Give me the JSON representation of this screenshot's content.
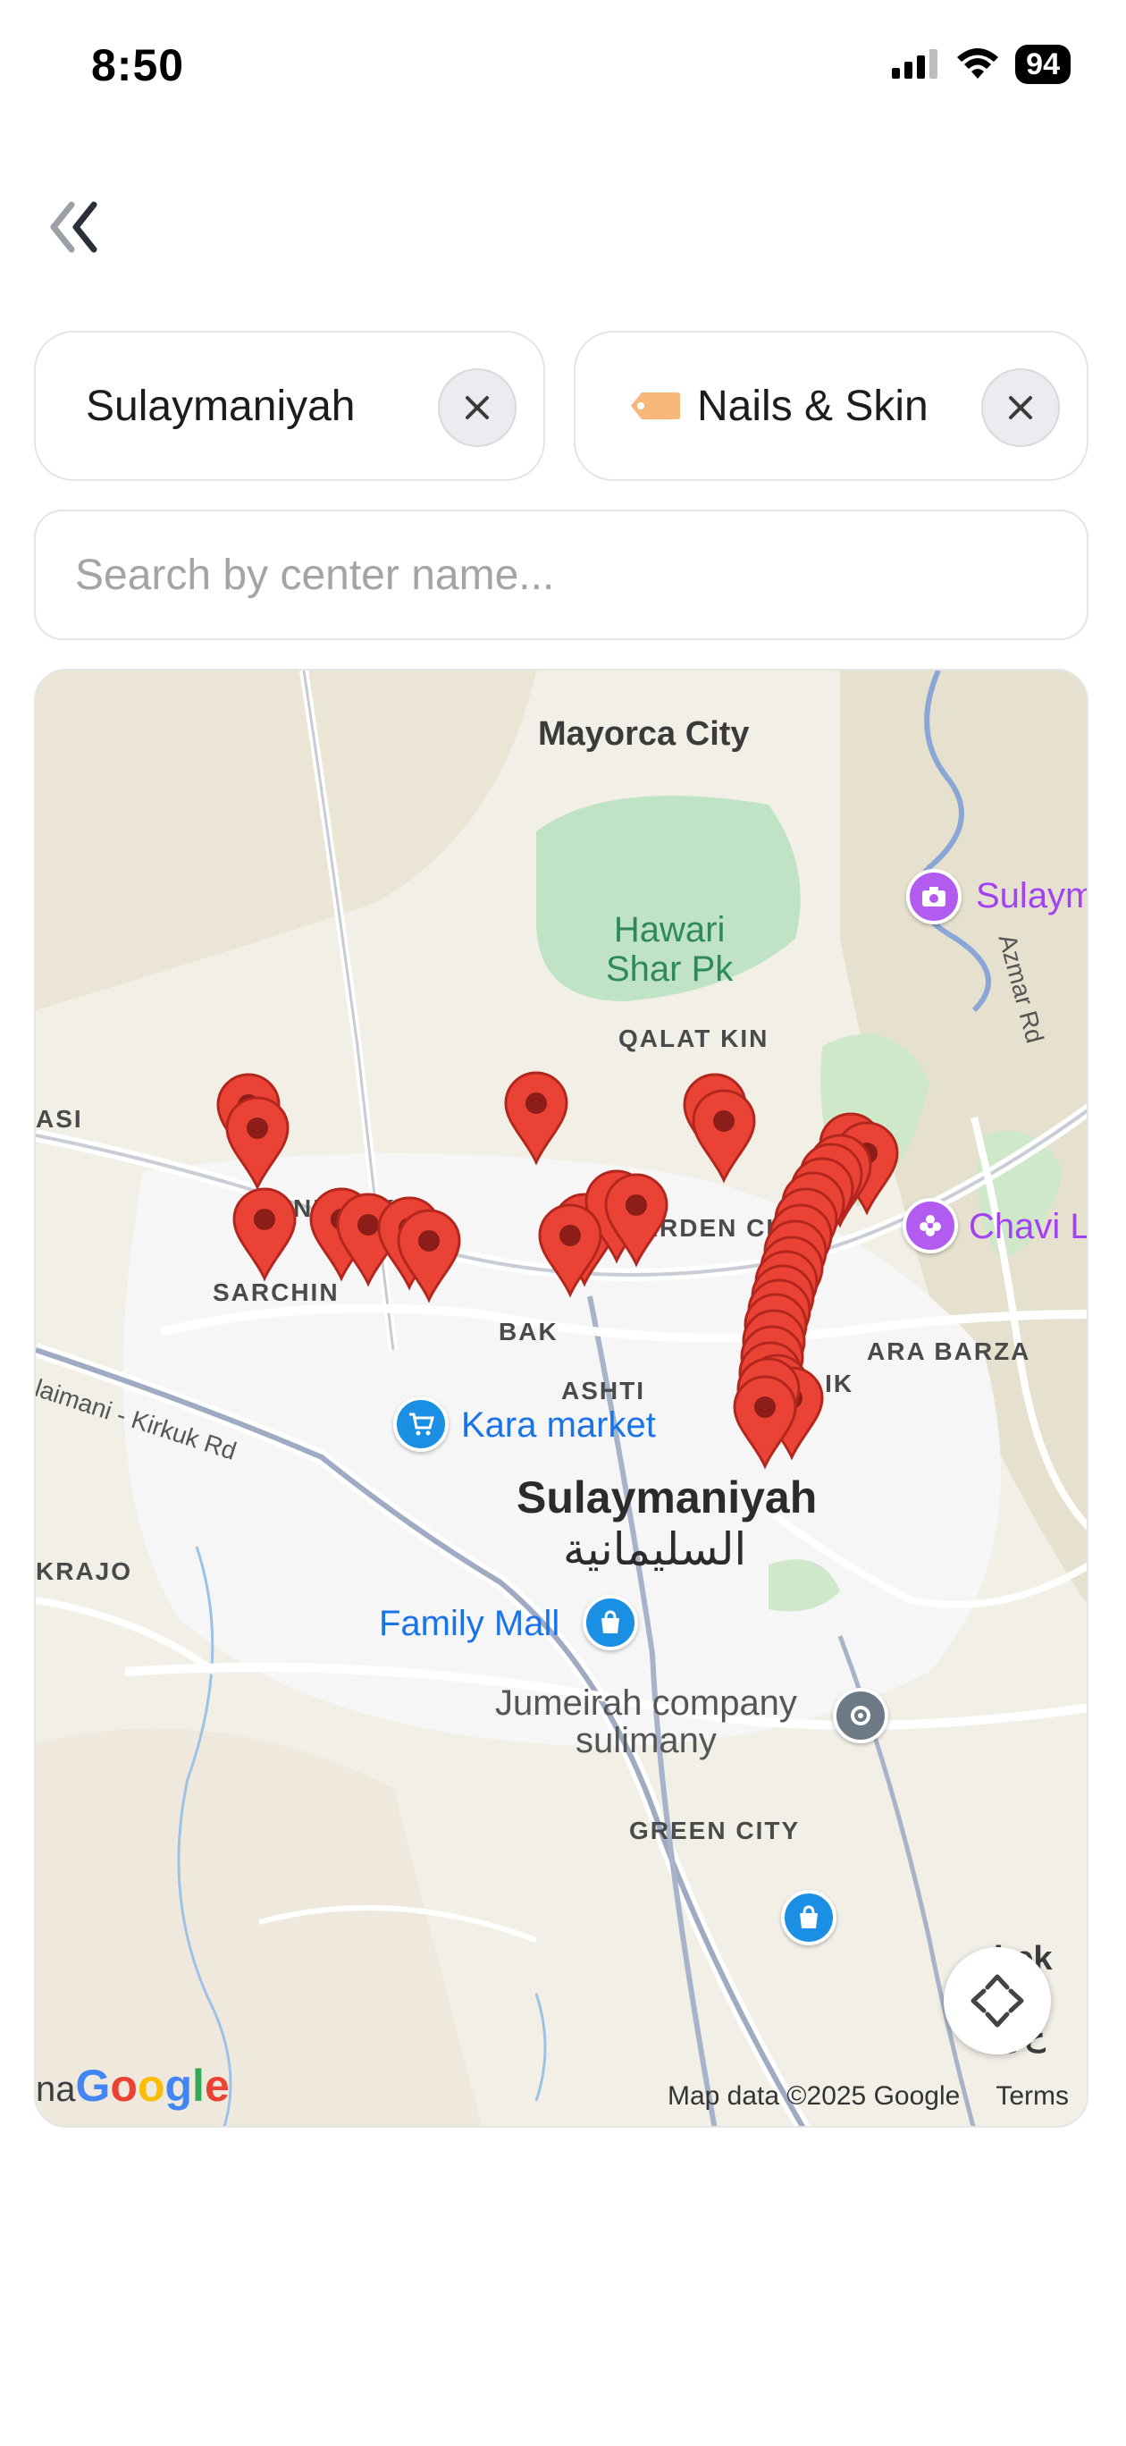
{
  "status_bar": {
    "time": "8:50",
    "battery": "94"
  },
  "filters": {
    "city": {
      "label": "Sulaymaniyah"
    },
    "category": {
      "label": "Nails & Skin"
    }
  },
  "search": {
    "placeholder": "Search by center name..."
  },
  "map": {
    "labels": {
      "mayorca_city": "Mayorca City",
      "hawari_park_line1": "Hawari",
      "hawari_park_line2": "Shar Pk",
      "qalat_kin": "QALAT KIN",
      "sulaymaniyah_poi": "Sulayma",
      "azmar_rd": "Azmar Rd",
      "asi": "ASI",
      "ni_spika": "NI SPIKA",
      "garden_city": "GARDEN CITY",
      "chavi": "Chavi L",
      "sarchinar": "SARCHIN",
      "bakhtiari": "BAK",
      "ashti": "ASHTI",
      "kara_barza": "ARA BARZA",
      "tuymalik": "LIK",
      "sulaimani_kirkuk_rd": "ulaimani - Kirkuk Rd",
      "kara_market": "Kara market",
      "city_name": "Sulaymaniyah",
      "city_name_ar": "السليمانية",
      "kurdsat_area": "KRAJO",
      "family_mall": "Family Mall",
      "jumeirah_line1": "Jumeirah company",
      "jumeirah_line2": "sulimany",
      "green_city": "GREEN CITY",
      "shekh_line1": "hek",
      "shekh_line2": "av",
      "shekh_line3": "ع خ"
    },
    "google_logo": "Google",
    "google_prefix": "na",
    "attribution": "Map data ©2025 Google",
    "terms": "Terms",
    "accent": "#ea4335"
  }
}
